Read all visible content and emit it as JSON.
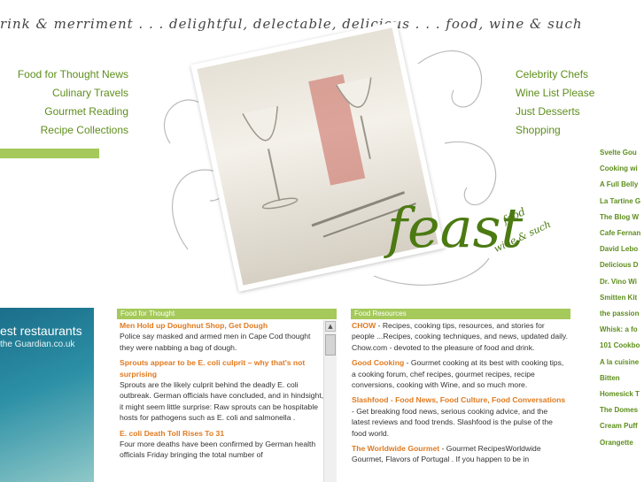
{
  "banner": {
    "tagline": "rink & merriment . . . delightful, delectable, delicious . . . food, wine & such"
  },
  "left_nav": [
    "Food for Thought News",
    "Culinary Travels",
    "Gourmet Reading",
    "Recipe Collections"
  ],
  "right_nav": [
    "Celebrity Chefs",
    "Wine List Please",
    "Just Desserts",
    "Shopping"
  ],
  "brand": {
    "name": "feast",
    "line1": "food",
    "line2": "wine & such"
  },
  "right_links": [
    "Svelte Gou",
    "Cooking wi",
    "A Full Belly",
    "La Tartine G",
    "The Blog W",
    "Cafe Fernan",
    "David Lebo",
    "Delicious D",
    "Dr. Vino Wi",
    "Smitten Kit",
    "the passion",
    "Whisk: a fo",
    "101 Cookbo",
    "A la cuisine",
    "Bitten",
    "Homesick T",
    "The Domes",
    "Cream Puff",
    "Orangette"
  ],
  "ad": {
    "title": "est restaurants",
    "subtitle": "the Guardian.co.uk"
  },
  "food_for_thought": {
    "header": "Food for Thought",
    "items": [
      {
        "title": "Men Hold up Doughnut Shop, Get Dough",
        "body": "Police say masked and armed men in Cape Cod thought they were nabbing a bag of dough."
      },
      {
        "title": "Sprouts appear to be E. coli culprit – why that's not surprising",
        "body": "Sprouts are the likely culprit behind the deadly E. coli outbreak. German officials have concluded, and in hindsight, it might seem little surprise: Raw sprouts can be hospitable hosts for pathogens such as E. coli and salmonella ."
      },
      {
        "title": "E. coli Death Toll Rises To 31",
        "body": "Four more deaths have been confirmed by German health officials Friday bringing the total number of"
      }
    ]
  },
  "food_resources": {
    "header": "Food Resources",
    "items": [
      {
        "name": "CHOW",
        "desc": " - Recipes, cooking tips, resources, and stories for people ...Recipes, cooking techniques, and news, updated daily. Chow.com - devoted to the pleasure of food and drink."
      },
      {
        "name": "Good Cooking",
        "desc": " - Gourmet cooking at its best with cooking tips, a cooking forum, chef recipes, gourmet recipes, recipe conversions, cooking with Wine, and so much more."
      },
      {
        "name": "Slashfood - Food News, Food Culture, Food Conversations",
        "desc": " - Get breaking food news, serious cooking advice, and the latest reviews and food trends. Slashfood is the pulse of the food world."
      },
      {
        "name": "The Worldwide Gourmet",
        "desc": " - Gourmet RecipesWorldwide Gourmet, Flavors of Portugal . If you happen to be in"
      }
    ]
  },
  "colors": {
    "accent_green": "#a5c95a",
    "link_green": "#5e8e1c",
    "headline_orange": "#e07a1f"
  }
}
